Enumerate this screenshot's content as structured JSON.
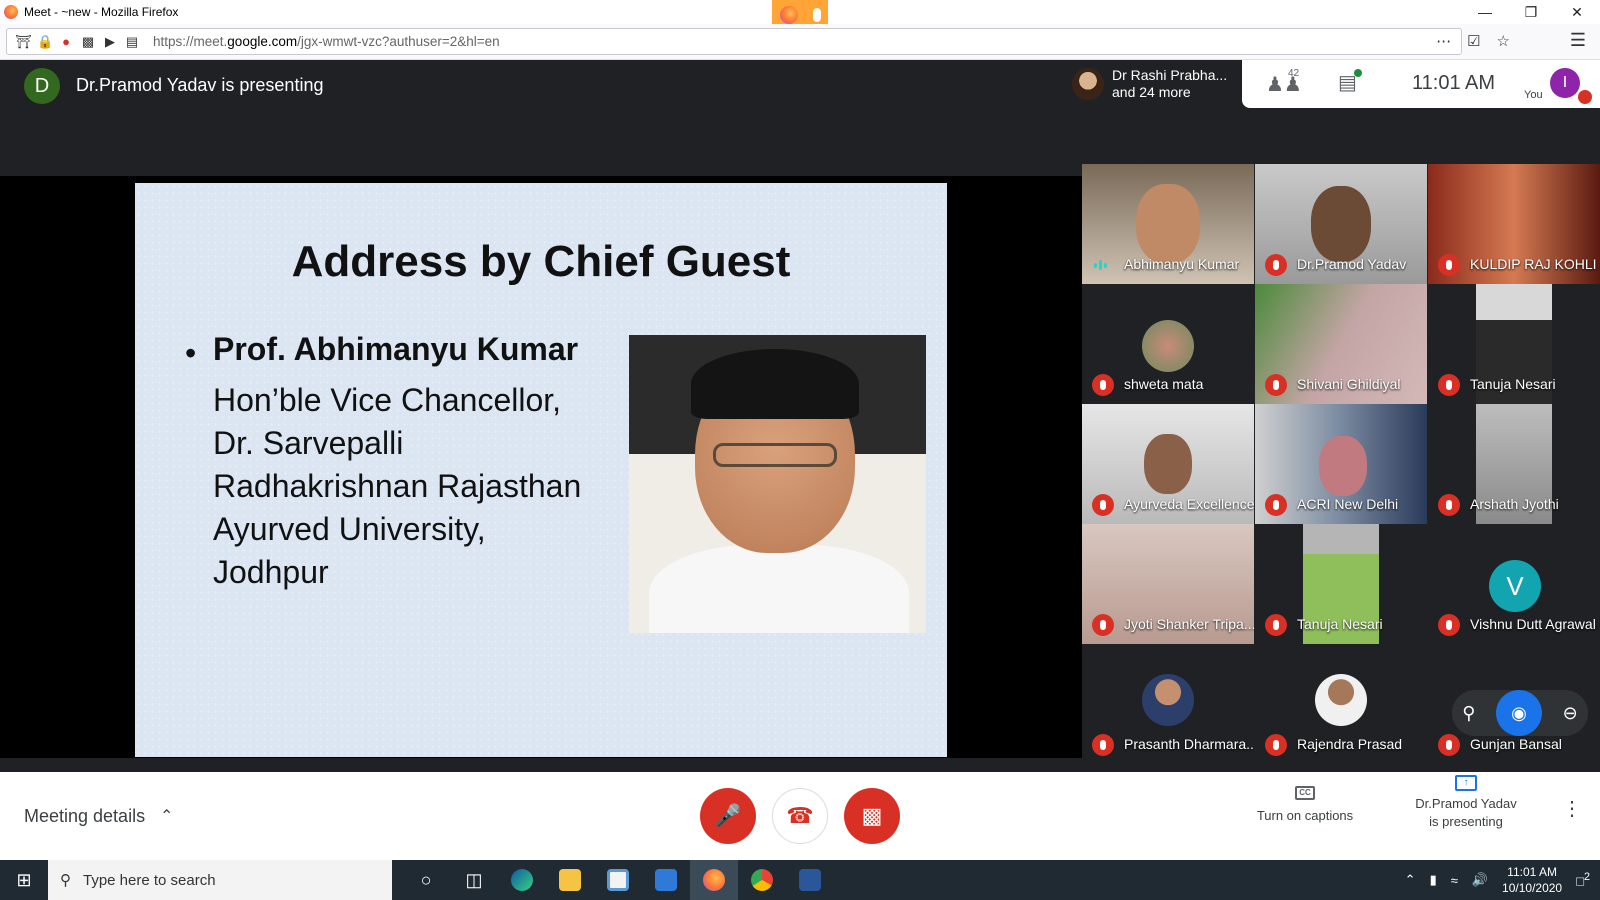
{
  "window": {
    "title": "Meet - ~new - Mozilla Firefox",
    "url_prefix": "https://meet.",
    "url_domain": "google.com",
    "url_rest": "/jgx-wmwt-vzc?authuser=2&hl=en"
  },
  "meet": {
    "presenter_initial": "D",
    "presenter_text": "Dr.Pramod Yadav is presenting",
    "attendees_line1": "Dr Rashi Prabha...",
    "attendees_line2": "and 24 more",
    "people_count": "42",
    "time": "11:01  AM",
    "you_label": "You",
    "you_initial": "I"
  },
  "slide": {
    "title": "Address by Chief Guest",
    "bullet": "•",
    "guest_name": "Prof. Abhimanyu Kumar",
    "line1": "Hon’ble Vice Chancellor,",
    "line2": "Dr. Sarvepalli",
    "line3": "Radhakrishnan Rajasthan",
    "line4": "Ayurved University,",
    "line5": "Jodhpur"
  },
  "participants": [
    {
      "name": "Abhimanyu Kumar"
    },
    {
      "name": "Dr.Pramod Yadav"
    },
    {
      "name": "KULDIP RAJ KOHLI"
    },
    {
      "name": "shweta mata"
    },
    {
      "name": "Shivani Ghildiyal"
    },
    {
      "name": "Tanuja Nesari"
    },
    {
      "name": "Ayurveda Excellence"
    },
    {
      "name": "ACRI New Delhi"
    },
    {
      "name": "Arshath Jyothi"
    },
    {
      "name": "Jyoti Shanker Tripa..."
    },
    {
      "name": "Tanuja Nesari"
    },
    {
      "name": "Vishnu Dutt Agrawal",
      "initial": "V"
    },
    {
      "name": "Prasanth Dharmara..."
    },
    {
      "name": "Rajendra Prasad"
    },
    {
      "name": "Gunjan Bansal"
    }
  ],
  "bottom": {
    "meeting_details": "Meeting details",
    "captions": "Turn on captions",
    "cc": "CC",
    "presenting_line1": "Dr.Pramod Yadav",
    "presenting_line2": "is presenting"
  },
  "taskbar": {
    "search_placeholder": "Type here to search",
    "time": "11:01 AM",
    "date": "10/10/2020",
    "notifications": "2"
  },
  "colors": {
    "meet_dark": "#202124",
    "mute_red": "#d93025",
    "presenter_green": "#33691e",
    "you_purple": "#8e24aa",
    "vishnu_teal": "#12a4af"
  }
}
